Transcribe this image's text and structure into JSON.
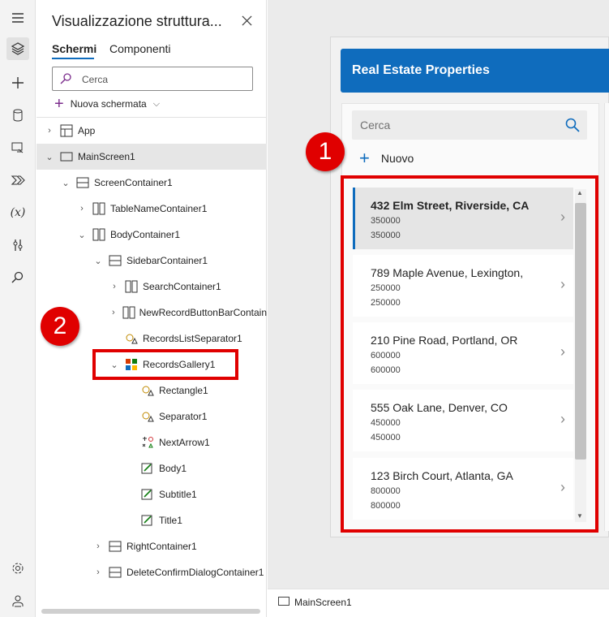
{
  "rail": {
    "items": [
      "menu-icon",
      "layers-icon",
      "add-icon",
      "data-icon",
      "media-icon",
      "power-automate-icon",
      "variables-icon",
      "tools-icon",
      "search-icon",
      "settings-icon",
      "account-icon"
    ],
    "variables_label": "(x)"
  },
  "tree_panel": {
    "title": "Visualizzazione struttura...",
    "tabs": [
      "Schermi",
      "Componenti"
    ],
    "search_placeholder": "Cerca",
    "new_screen_label": "Nuova schermata",
    "rows": [
      {
        "label": "App",
        "icon": "app-icon",
        "caret": ">"
      },
      {
        "label": "MainScreen1",
        "icon": "screen-icon",
        "caret": "v",
        "selected": true
      },
      {
        "label": "ScreenContainer1",
        "icon": "vertical-container-icon",
        "caret": "v"
      },
      {
        "label": "TableNameContainer1",
        "icon": "horizontal-container-icon",
        "caret": ">"
      },
      {
        "label": "BodyContainer1",
        "icon": "horizontal-container-icon",
        "caret": "v"
      },
      {
        "label": "SidebarContainer1",
        "icon": "vertical-container-icon",
        "caret": "v"
      },
      {
        "label": "SearchContainer1",
        "icon": "horizontal-container-icon",
        "caret": ">"
      },
      {
        "label": "NewRecordButtonBarContain",
        "icon": "horizontal-container-icon",
        "caret": ">"
      },
      {
        "label": "RecordsListSeparator1",
        "icon": "shape-icon",
        "caret": ""
      },
      {
        "label": "RecordsGallery1",
        "icon": "gallery-icon",
        "caret": "v"
      },
      {
        "label": "Rectangle1",
        "icon": "shape-icon",
        "caret": ""
      },
      {
        "label": "Separator1",
        "icon": "shape-icon",
        "caret": ""
      },
      {
        "label": "NextArrow1",
        "icon": "icons-icon",
        "caret": ""
      },
      {
        "label": "Body1",
        "icon": "label-icon",
        "caret": ""
      },
      {
        "label": "Subtitle1",
        "icon": "label-icon",
        "caret": ""
      },
      {
        "label": "Title1",
        "icon": "label-icon",
        "caret": ""
      },
      {
        "label": "RightContainer1",
        "icon": "vertical-container-icon",
        "caret": ">"
      },
      {
        "label": "DeleteConfirmDialogContainer1",
        "icon": "vertical-container-icon",
        "caret": ">"
      }
    ]
  },
  "callouts": {
    "badge_1": "1",
    "badge_2": "2"
  },
  "app": {
    "title": "Real Estate Properties",
    "search_placeholder": "Cerca",
    "new_label": "Nuovo",
    "records": [
      {
        "address": "432 Elm Street, Riverside, CA",
        "subtitle": "350000",
        "body": "350000",
        "selected": true
      },
      {
        "address": "789 Maple Avenue, Lexington,",
        "subtitle": "250000",
        "body": "250000"
      },
      {
        "address": "210 Pine Road, Portland, OR",
        "subtitle": "600000",
        "body": "600000"
      },
      {
        "address": "555 Oak Lane, Denver, CO",
        "subtitle": "450000",
        "body": "450000"
      },
      {
        "address": "123 Birch Court, Atlanta, GA",
        "subtitle": "800000",
        "body": "800000"
      }
    ]
  },
  "status": {
    "screen_name": "MainScreen1"
  },
  "colors": {
    "accent": "#0f6cbd",
    "callout_red": "#e00000",
    "selected_row": "#e6e6e6"
  }
}
